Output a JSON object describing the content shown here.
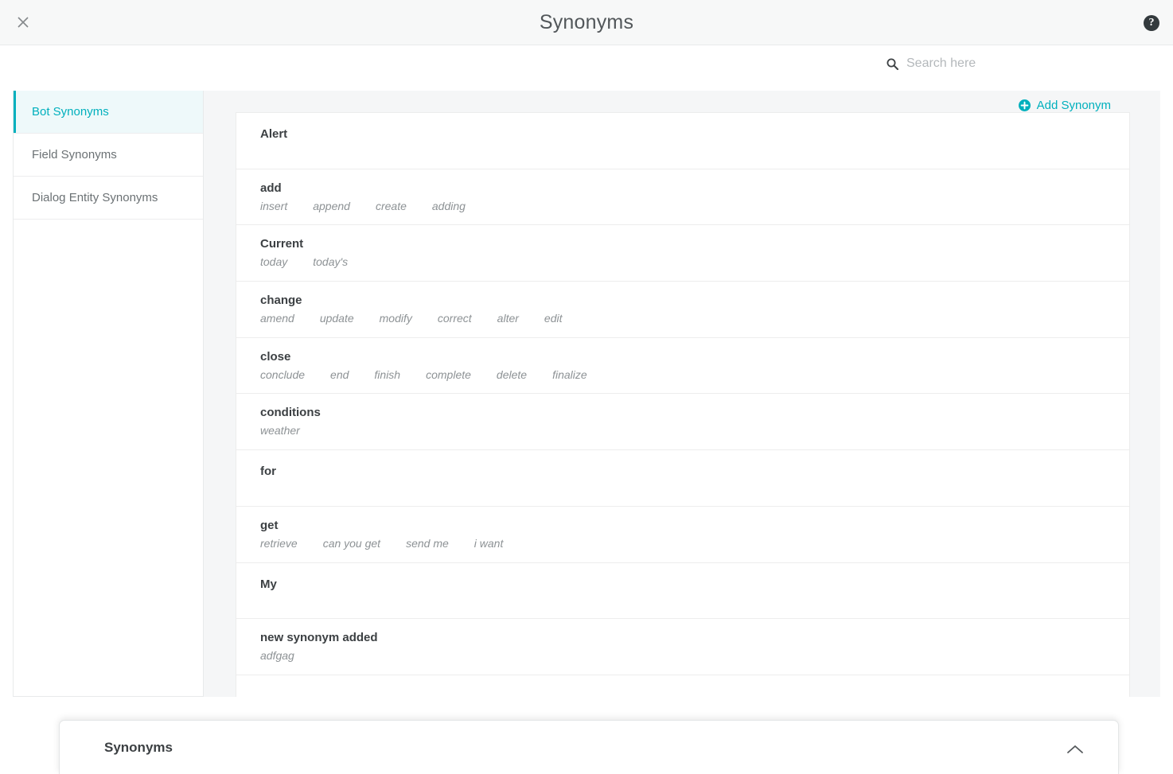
{
  "titlebar": {
    "title": "Synonyms",
    "close_icon": "close-icon",
    "help_icon": "help-icon",
    "help_label": "?"
  },
  "search": {
    "icon": "search-icon",
    "placeholder": "Search here",
    "value": ""
  },
  "sidebar": {
    "items": [
      {
        "label": "Bot Synonyms",
        "active": true
      },
      {
        "label": "Field Synonyms",
        "active": false
      },
      {
        "label": "Dialog Entity Synonyms",
        "active": false
      }
    ]
  },
  "actionbar": {
    "add_label": "Add Synonym",
    "add_icon": "plus-circle-icon",
    "accent_color": "#00b0bd"
  },
  "list": {
    "rows": [
      {
        "term": "Alert",
        "synonyms": []
      },
      {
        "term": "add",
        "synonyms": [
          "insert",
          "append",
          "create",
          "adding"
        ]
      },
      {
        "term": "Current",
        "synonyms": [
          "today",
          "today's"
        ]
      },
      {
        "term": "change",
        "synonyms": [
          "amend",
          "update",
          "modify",
          "correct",
          "alter",
          "edit"
        ]
      },
      {
        "term": "close",
        "synonyms": [
          "conclude",
          "end",
          "finish",
          "complete",
          "delete",
          "finalize"
        ]
      },
      {
        "term": "conditions",
        "synonyms": [
          "weather"
        ]
      },
      {
        "term": "for",
        "synonyms": []
      },
      {
        "term": "get",
        "synonyms": [
          "retrieve",
          "can you get",
          "send me",
          "i want"
        ]
      },
      {
        "term": "My",
        "synonyms": []
      },
      {
        "term": "new synonym added",
        "synonyms": [
          "adfgag"
        ]
      }
    ]
  },
  "dock": {
    "title": "Synonyms",
    "toggle_icon": "chevron-up-icon"
  }
}
